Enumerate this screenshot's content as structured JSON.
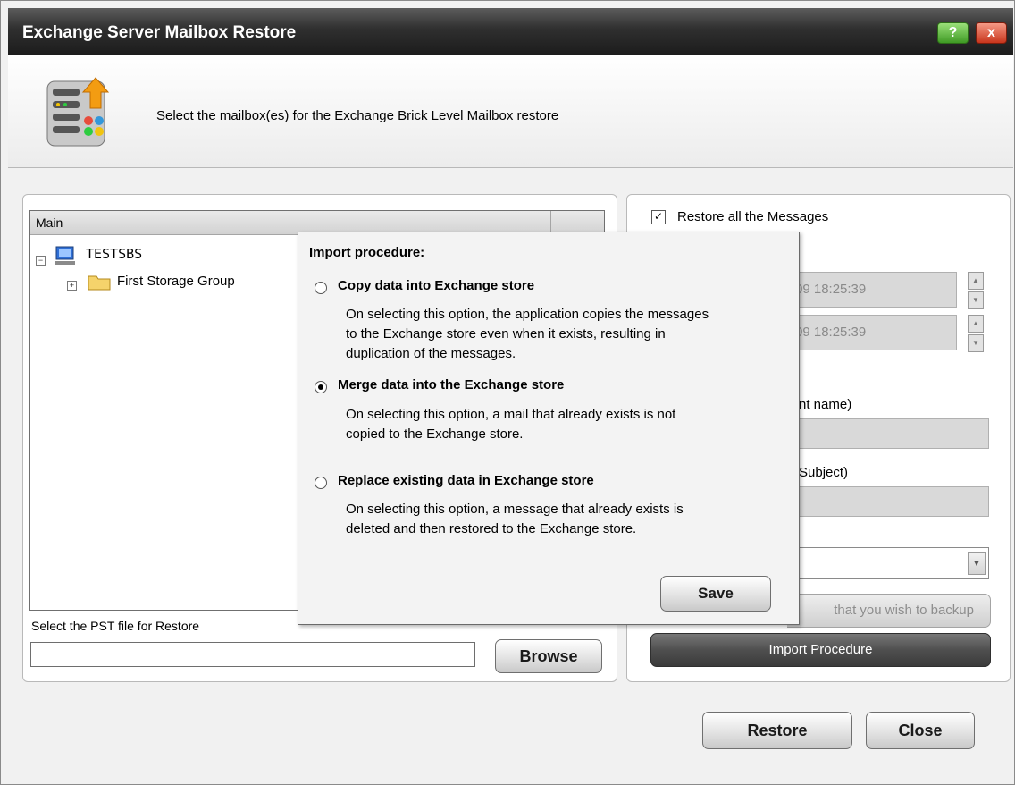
{
  "window": {
    "title": "Exchange Server Mailbox Restore",
    "help_glyph": "?",
    "close_glyph": "x"
  },
  "header": {
    "text": "Select the mailbox(es) for the Exchange Brick Level Mailbox restore",
    "icon": "server-restore-icon"
  },
  "tree": {
    "column": "Main",
    "nodes": [
      {
        "label": "TESTSBS",
        "toggle": "−",
        "icon": "computer-icon"
      },
      {
        "label": "First Storage Group",
        "toggle": "+",
        "icon": "folder-icon"
      }
    ]
  },
  "pst": {
    "label": "Select the PST file for Restore",
    "value": "",
    "browse": "Browse"
  },
  "right": {
    "restore_all": {
      "label": "Restore all the Messages",
      "checked": true,
      "glyph": "✓"
    },
    "date_from": "09 18:25:39",
    "date_to": "09 18:25:39",
    "recipient_label": "nt name)",
    "subject_label": "Subject)",
    "select_folders": "that you wish to backup",
    "import_procedure": "Import Procedure"
  },
  "popup": {
    "title": "Import procedure:",
    "options": [
      {
        "title": "Copy data into Exchange store",
        "checked": false,
        "desc": [
          "On selecting this option, the application copies the messages",
          "to the Exchange store even when it exists, resulting in",
          "duplication of the messages."
        ]
      },
      {
        "title": "Merge data into the Exchange store",
        "checked": true,
        "desc": [
          "On selecting this option, a mail that already exists is not",
          "copied to the Exchange store."
        ]
      },
      {
        "title": "Replace existing data in Exchange store",
        "checked": false,
        "desc": [
          "On selecting this option, a message that already exists is",
          "deleted and then restored to the Exchange store."
        ]
      }
    ],
    "save": "Save"
  },
  "footer": {
    "restore": "Restore",
    "close": "Close"
  }
}
